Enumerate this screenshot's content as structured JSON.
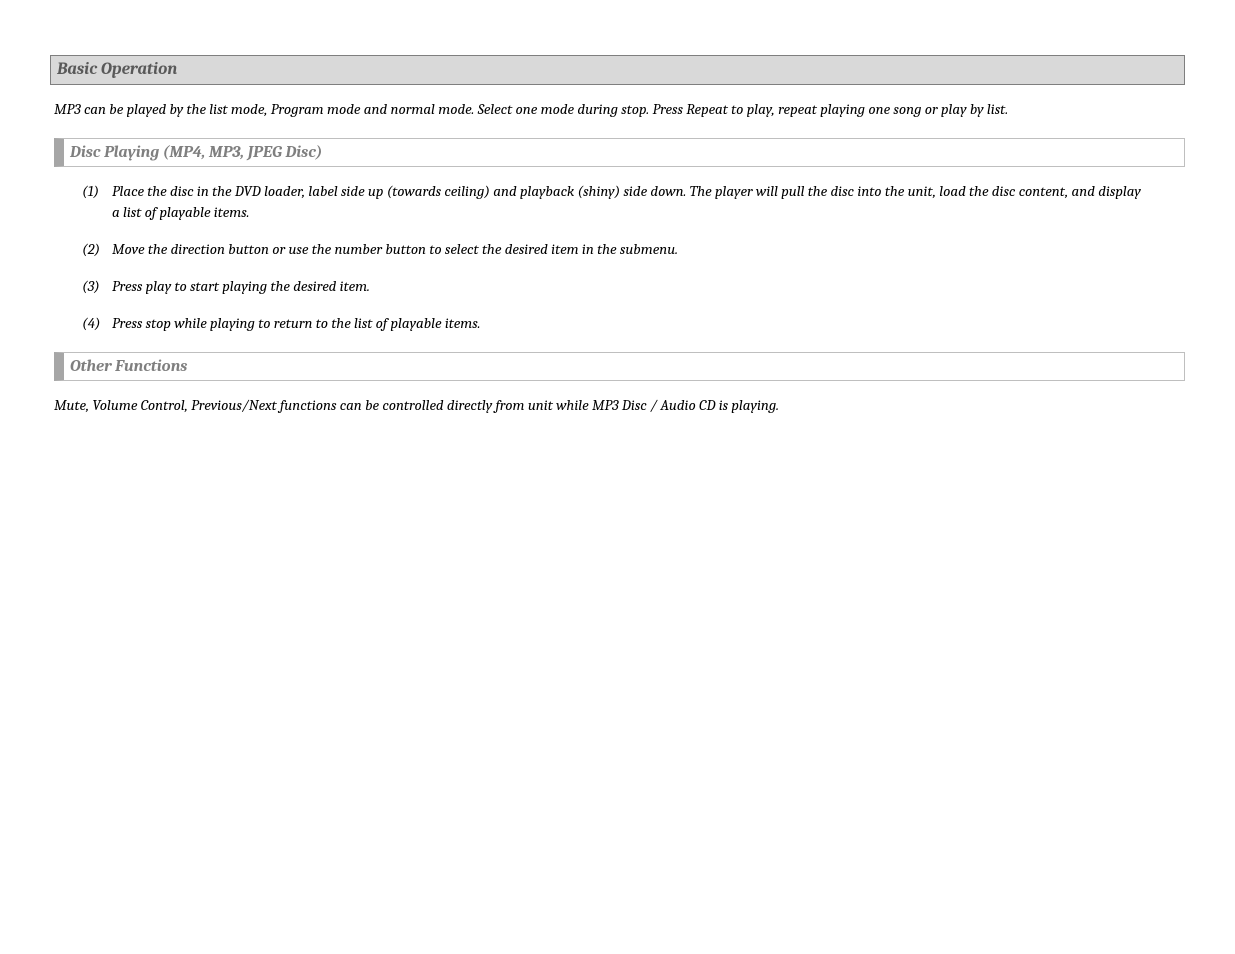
{
  "heading1": "Basic Operation",
  "intro": "MP3 can be played by the list mode, Program mode and normal mode. Select one mode during stop. Press Repeat to play, repeat playing one song or play by list.",
  "heading2": "Disc Playing (MP4, MP3, JPEG Disc)",
  "steps": [
    {
      "num": "(1)",
      "text": "Place the disc in the DVD loader, label side up (towards ceiling) and playback (shiny) side down. The player will pull the disc into the unit, load the disc content, and display a list of playable items."
    },
    {
      "num": "(2)",
      "text": "Move the direction button or use the number button to select the desired item in the submenu."
    },
    {
      "num": "(3)",
      "text": "Press play to start playing the desired item."
    },
    {
      "num": "(4)",
      "text": "Press stop while playing to return to the list of playable items."
    }
  ],
  "heading3": "Other Functions",
  "other": "Mute, Volume Control, Previous/Next functions can be controlled directly from unit while MP3 Disc / Audio CD is playing."
}
